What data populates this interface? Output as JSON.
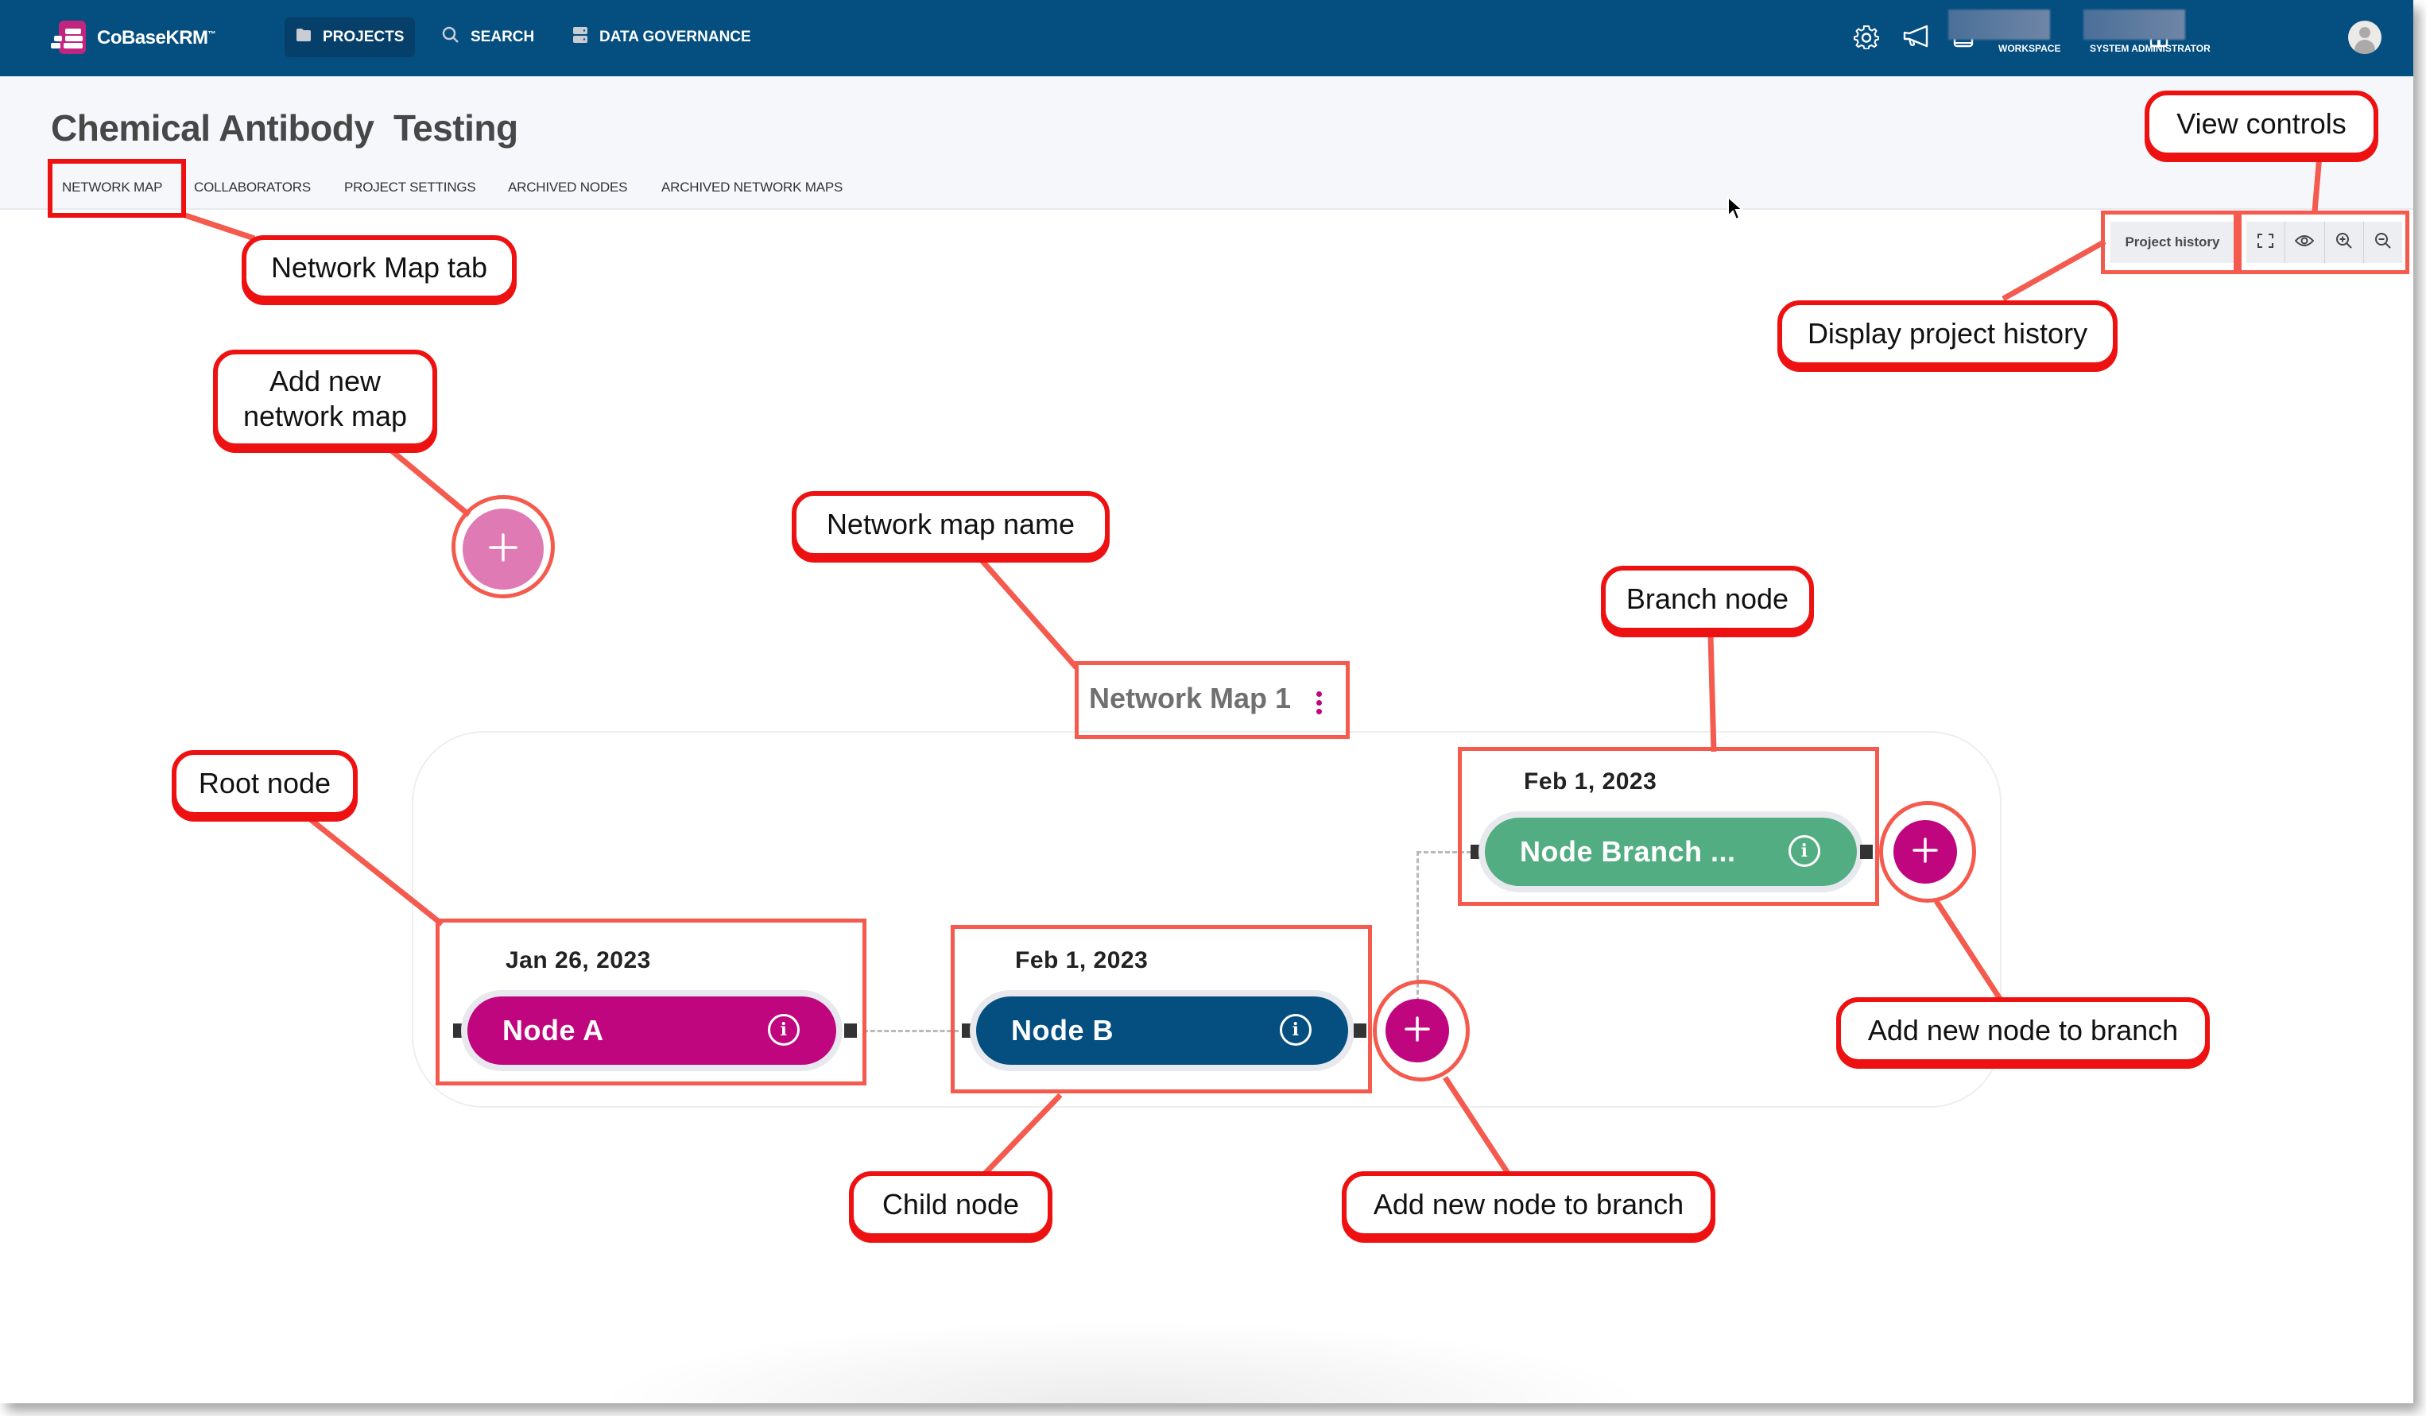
{
  "app": {
    "brand": "CoBaseKRM",
    "brand_tm": "™",
    "colors": {
      "nav_bg": "#044e80",
      "brand_pink": "#c0267f",
      "node_root": "#c0067f",
      "node_child": "#044e80",
      "node_branch": "#52ae82",
      "add_node": "#c0067f",
      "add_map": "#e07ab5",
      "annotation_red": "#ee1111"
    }
  },
  "topnav": {
    "items": [
      {
        "label": "PROJECTS",
        "icon": "folder-icon",
        "active": true
      },
      {
        "label": "SEARCH",
        "icon": "search-icon",
        "active": false
      },
      {
        "label": "DATA GOVERNANCE",
        "icon": "database-icon",
        "active": false
      }
    ],
    "icons": [
      "gear-icon",
      "megaphone-icon",
      "book-icon"
    ],
    "workspace_label": "WORKSPACE",
    "user_role_label": "SYSTEM ADMINISTRATOR"
  },
  "project": {
    "title": "Chemical Antibody  Testing",
    "tabs": [
      {
        "label": "NETWORK MAP",
        "active": true
      },
      {
        "label": "COLLABORATORS",
        "active": false
      },
      {
        "label": "PROJECT SETTINGS",
        "active": false
      },
      {
        "label": "ARCHIVED NODES",
        "active": false
      },
      {
        "label": "ARCHIVED NETWORK MAPS",
        "active": false
      }
    ]
  },
  "view_controls": {
    "project_history_label": "Project history",
    "buttons": [
      "fullscreen-icon",
      "eye-icon",
      "zoom-in-icon",
      "zoom-out-icon"
    ]
  },
  "network_map": {
    "name": "Network Map 1",
    "add_map_symbol": "+",
    "add_node_symbol": "+",
    "info_symbol": "i",
    "nodes": [
      {
        "role": "root",
        "label": "Node A",
        "date": "Jan 26, 2023"
      },
      {
        "role": "child",
        "label": "Node B",
        "date": "Feb 1, 2023"
      },
      {
        "role": "branch",
        "label": "Node Branch ...",
        "date": "Feb 1, 2023"
      }
    ]
  },
  "annotations": {
    "network_map_tab": "Network Map tab",
    "add_new_network_map": "Add new network map",
    "network_map_name": "Network map name",
    "branch_node": "Branch node",
    "root_node": "Root node",
    "child_node": "Child node",
    "add_node_to_branch_1": "Add new node to branch",
    "add_node_to_branch_2": "Add new node to branch",
    "view_controls": "View controls",
    "display_project_history": "Display project history"
  }
}
